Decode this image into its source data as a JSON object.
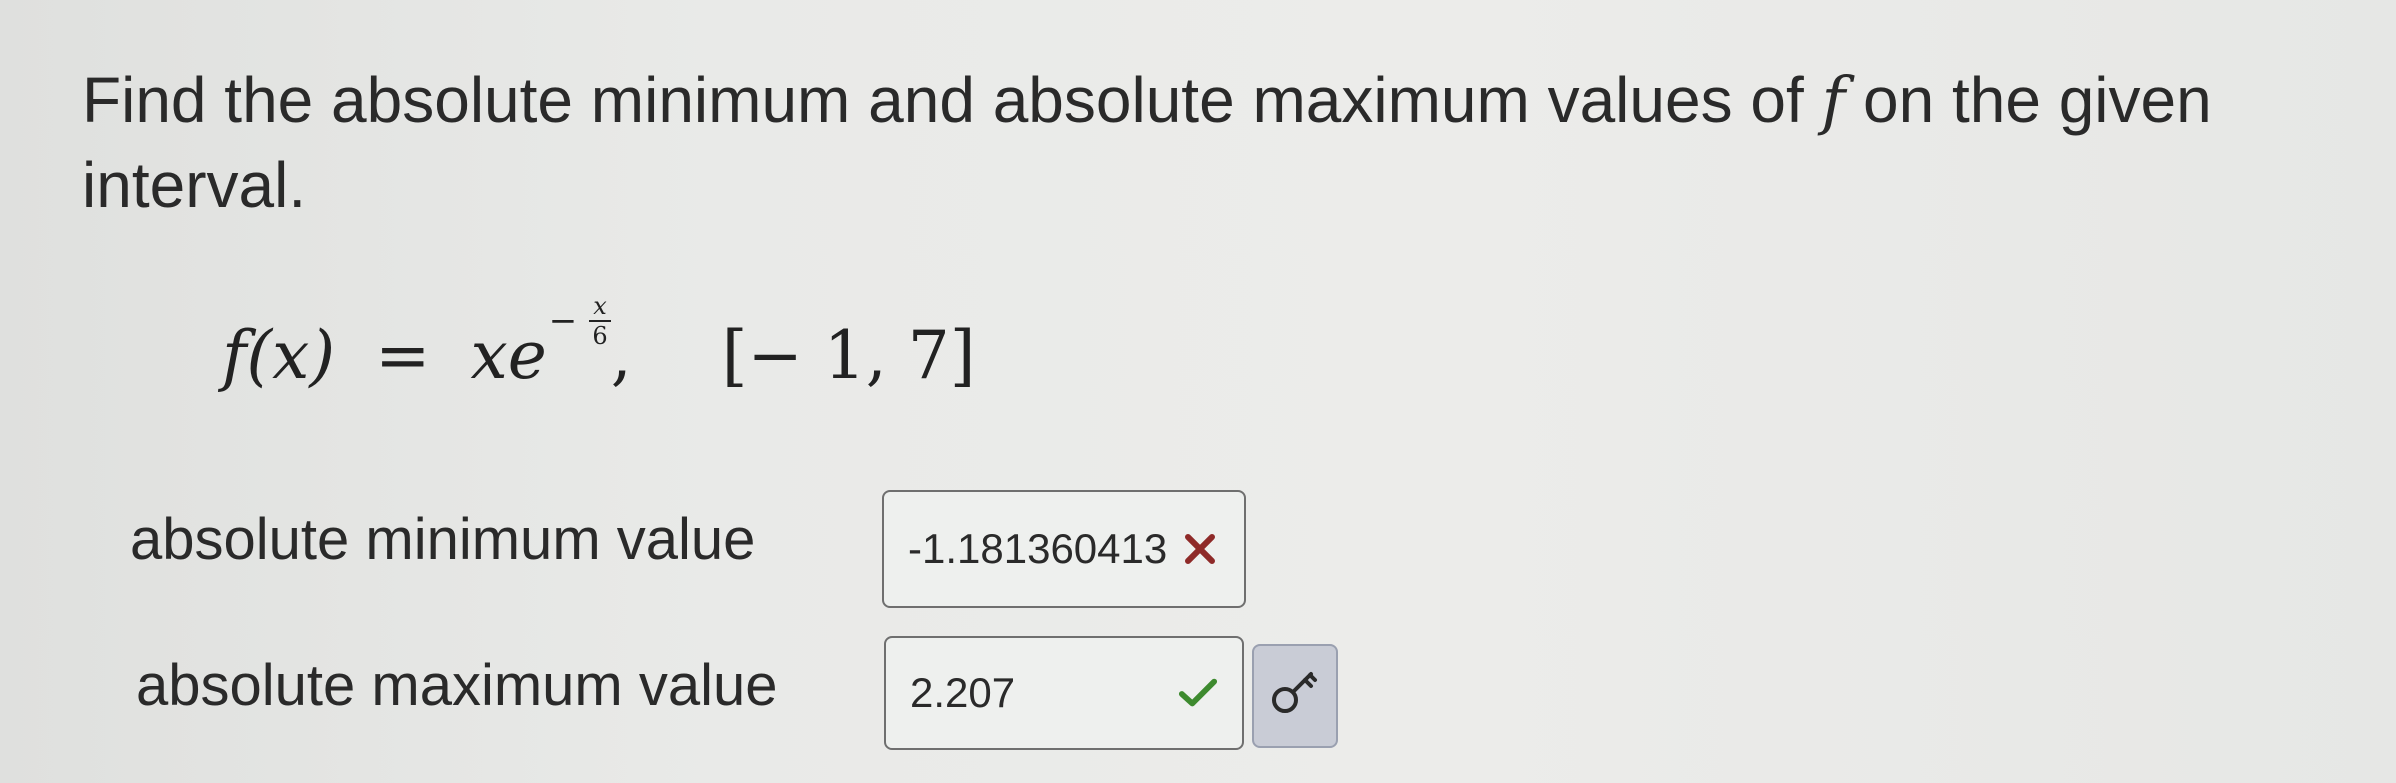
{
  "question": {
    "text_before": "Find the absolute minimum and absolute maximum values of ",
    "function_symbol": "f",
    "text_after": " on the given interval."
  },
  "formula": {
    "lhs": "f(x)",
    "equals": "=",
    "base": "xe",
    "exp_sign": "−",
    "exp_numerator": "x",
    "exp_denominator": "6",
    "comma": ",",
    "interval": "[− 1, 7]"
  },
  "answers": {
    "minimum": {
      "label": "absolute minimum value",
      "value": "-1.181360413",
      "status": "incorrect",
      "status_icon": "x-mark-icon",
      "status_color": "#8e2a28"
    },
    "maximum": {
      "label": "absolute maximum value",
      "value": "2.207",
      "status": "correct",
      "status_icon": "check-mark-icon",
      "status_color": "#3d8a2e"
    }
  },
  "key_button": {
    "icon": "key-icon"
  }
}
